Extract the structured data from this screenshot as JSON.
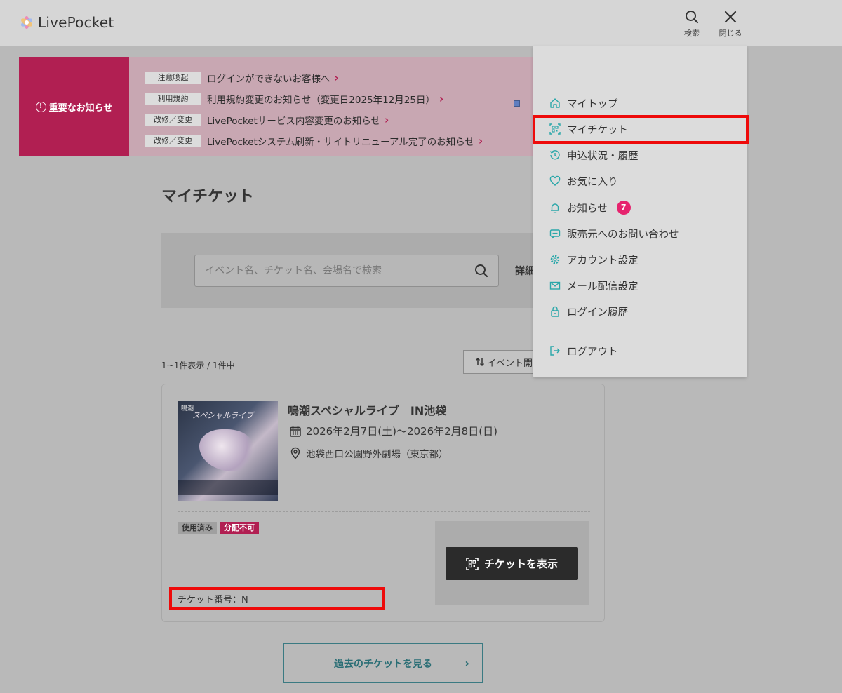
{
  "header": {
    "logo_text": "LivePocket",
    "search_label": "検索",
    "close_label": "閉じる"
  },
  "notice": {
    "heading": "重要なお知らせ",
    "items": [
      {
        "tag": "注意喚起",
        "text": "ログインができないお客様へ"
      },
      {
        "tag": "利用規約",
        "text": "利用規約変更のお知らせ（変更日2025年12月25日）"
      },
      {
        "tag": "改修／変更",
        "text": "LivePocketサービス内容変更のお知らせ"
      },
      {
        "tag": "改修／変更",
        "text": "LivePocketシステム刷新・サイトリニューアル完了のお知らせ"
      }
    ]
  },
  "main": {
    "page_title": "マイチケット",
    "search_placeholder": "イベント名、チケット名、会場名で検索",
    "detail_link": "詳細",
    "result_count": "1~1件表示 / 1件中",
    "sort_label": "イベント開"
  },
  "ticket": {
    "thumb_label": "鳴潮",
    "thumb_title": "スペシャルライブ",
    "title": "鳴潮スペシャルライブ　IN池袋",
    "date": "2026年2月7日(土)～2026年2月8日(日)",
    "venue": "池袋西口公園野外劇場（東京都）",
    "badge_used": "使用済み",
    "badge_nodist": "分配不可",
    "show_button": "チケットを表示",
    "ticket_number": "チケット番号：N"
  },
  "past_button": "過去のチケットを見る",
  "menu": {
    "items": [
      {
        "label": "マイトップ",
        "icon": "home-icon"
      },
      {
        "label": "マイチケット",
        "icon": "qr-ticket-icon"
      },
      {
        "label": "申込状況・履歴",
        "icon": "history-icon"
      },
      {
        "label": "お気に入り",
        "icon": "heart-icon"
      },
      {
        "label": "お知らせ",
        "icon": "bell-icon",
        "badge": "7"
      },
      {
        "label": "販売元へのお問い合わせ",
        "icon": "chat-icon"
      },
      {
        "label": "アカウント設定",
        "icon": "gear-icon"
      },
      {
        "label": "メール配信設定",
        "icon": "mail-icon"
      },
      {
        "label": "ログイン履歴",
        "icon": "lock-icon"
      },
      {
        "label": "ログアウト",
        "icon": "logout-icon"
      }
    ]
  },
  "colors": {
    "accent_teal": "#2aa7a9",
    "notice_red": "#b11f52",
    "badge_pink": "#e6236e",
    "highlight_red": "#ee0a0a"
  }
}
